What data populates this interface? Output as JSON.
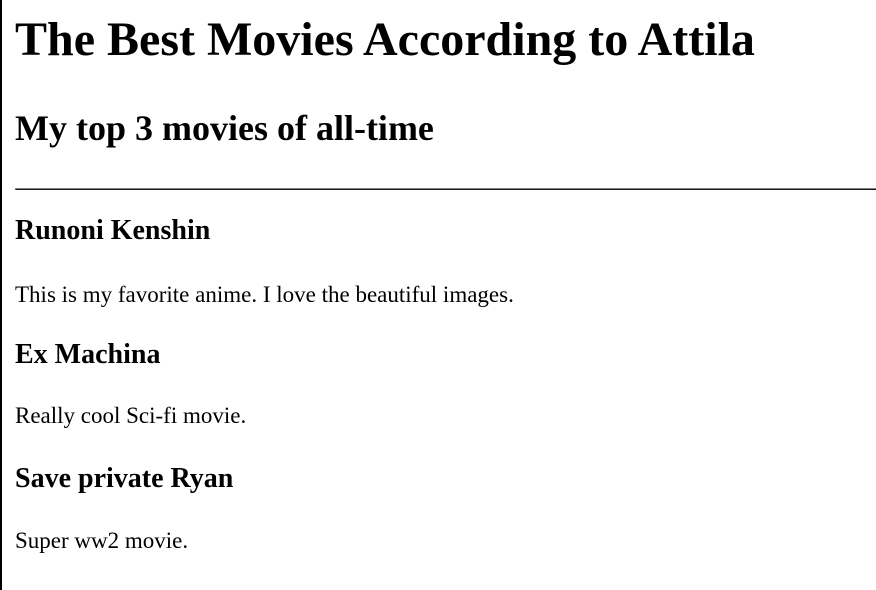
{
  "page": {
    "title": "The Best Movies According to Attila",
    "subtitle": "My top 3 movies of all-time"
  },
  "movies": [
    {
      "title": "Runoni Kenshin",
      "description": "This is my favorite anime. I love the beautiful images."
    },
    {
      "title": "Ex Machina",
      "description": "Really cool Sci-fi movie."
    },
    {
      "title": "Save private Ryan",
      "description": "Super ww2 movie."
    }
  ]
}
